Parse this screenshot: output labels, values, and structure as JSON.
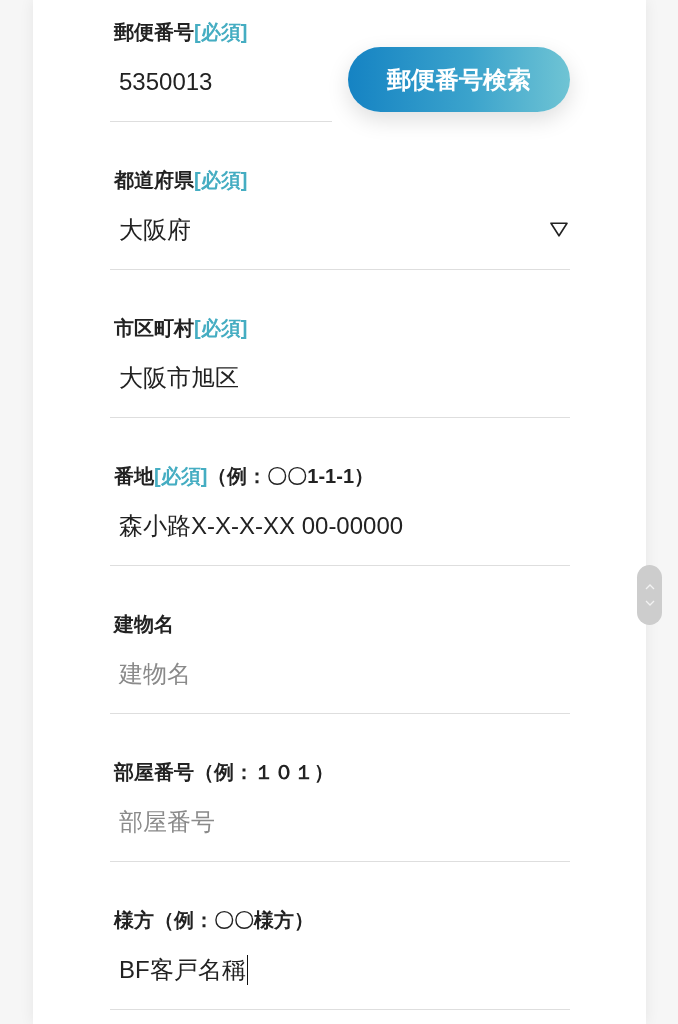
{
  "fields": [
    {
      "kind": "input",
      "label": "郵便番号",
      "required_tag": "[必須]",
      "value": "5350013",
      "focused": false,
      "button": {
        "label": "郵便番号検索"
      }
    },
    {
      "kind": "select",
      "label": "都道府県",
      "required_tag": "[必須]",
      "value": "大阪府",
      "focused": false
    },
    {
      "kind": "input",
      "label": "市区町村",
      "required_tag": "[必須]",
      "value": "大阪市旭区",
      "focused": false
    },
    {
      "kind": "input",
      "label": "番地",
      "required_tag": "[必須]",
      "note": "（例：〇〇1-1-1）",
      "value": "森小路X-X-X-XX 00-00000",
      "focused": false
    },
    {
      "kind": "input",
      "label": "建物名",
      "placeholder": "建物名",
      "focused": false
    },
    {
      "kind": "input",
      "label": "部屋番号",
      "note": "（例：１０１）",
      "placeholder": "部屋番号",
      "focused": false
    },
    {
      "kind": "input",
      "label": "様方",
      "note": "（例：〇〇様方）",
      "value": "BF客戸名稱",
      "focused": true
    }
  ]
}
